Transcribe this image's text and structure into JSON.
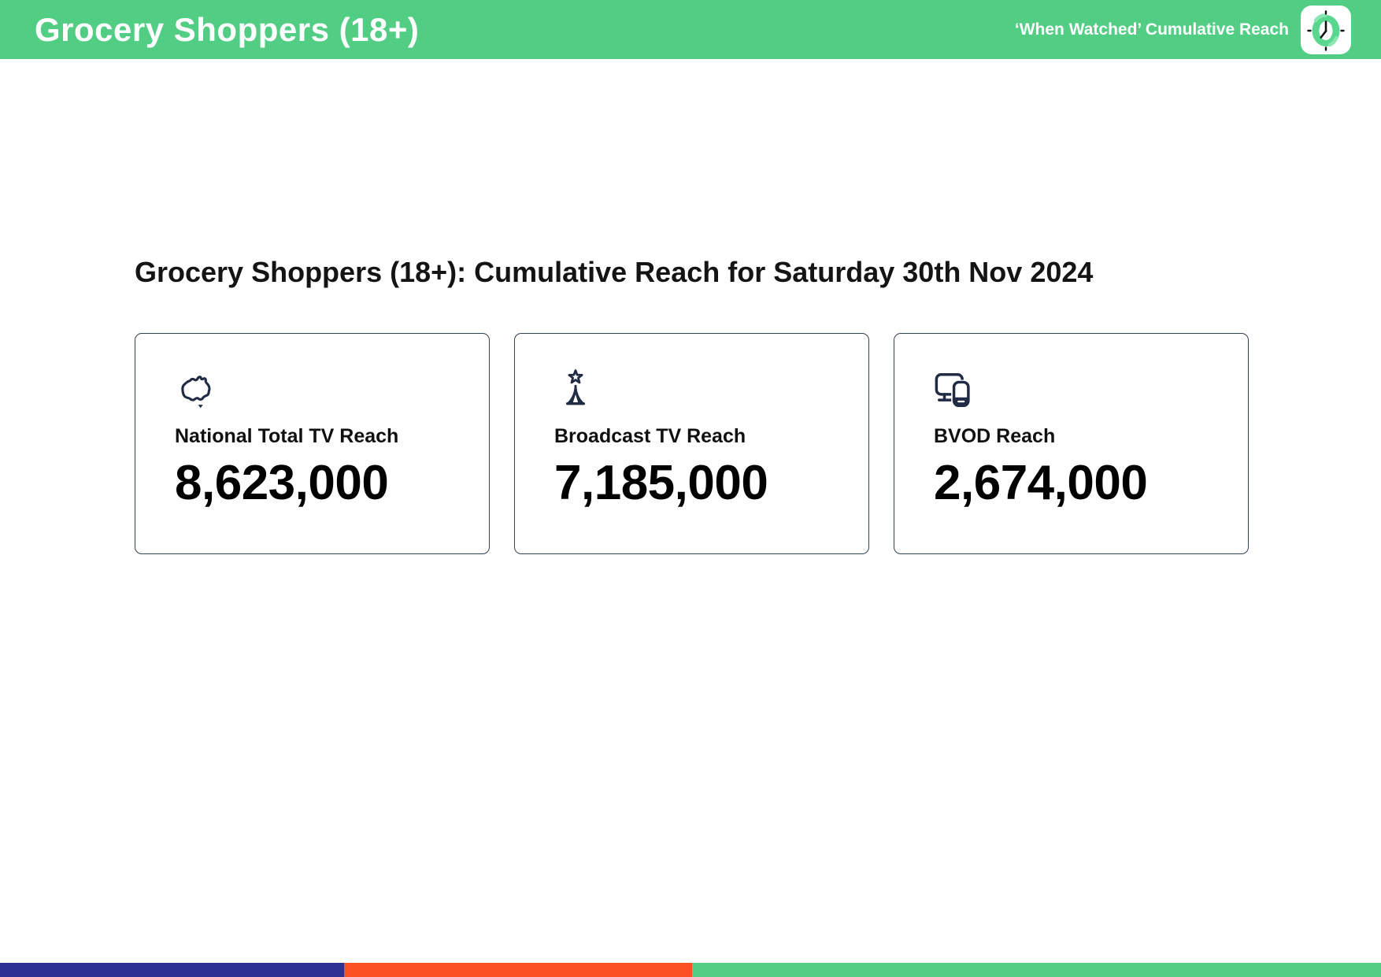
{
  "header": {
    "title": "Grocery Shoppers (18+)",
    "subtitle": "‘When Watched’ Cumulative Reach",
    "logo_icon": "clock-logo-icon"
  },
  "main": {
    "heading": "Grocery Shoppers (18+): Cumulative Reach for Saturday 30th Nov 2024",
    "cards": [
      {
        "icon": "australia-map-icon",
        "label": "National Total TV Reach",
        "value": "8,623,000"
      },
      {
        "icon": "broadcast-tower-icon",
        "label": "Broadcast TV Reach",
        "value": "7,185,000"
      },
      {
        "icon": "tv-devices-icon",
        "label": "BVOD Reach",
        "value": "2,674,000"
      }
    ]
  },
  "footer": {
    "segments": [
      {
        "name": "blue",
        "color": "#2E3192",
        "width_pct": 24.9
      },
      {
        "name": "orange",
        "color": "#FA5123",
        "width_pct": 25.2
      },
      {
        "name": "green",
        "color": "#52CE84",
        "width_pct": 49.9
      }
    ]
  },
  "colors": {
    "brand_green": "#52CE84",
    "icon_navy": "#212B45",
    "card_border": "#333F54",
    "heading_text": "#141414"
  }
}
